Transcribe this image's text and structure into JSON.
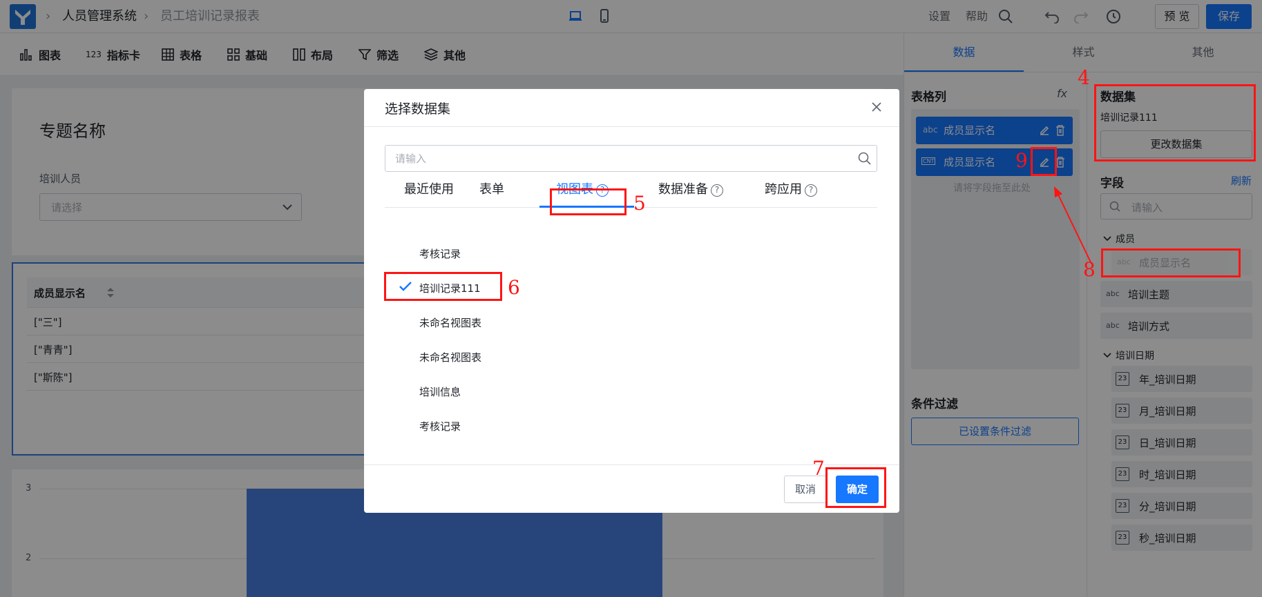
{
  "header": {
    "crumbs": [
      "人员管理系统",
      "员工培训记录报表"
    ],
    "settings_label": "设置",
    "help_label": "帮助",
    "preview_label": "预 览",
    "save_label": "保存"
  },
  "toolbar": {
    "items": [
      {
        "icon": "bar-chart-icon",
        "label": "图表"
      },
      {
        "icon": "number-card-icon",
        "label": "指标卡"
      },
      {
        "icon": "table-icon",
        "label": "表格"
      },
      {
        "icon": "grid-icon",
        "label": "基础"
      },
      {
        "icon": "layout-icon",
        "label": "布局"
      },
      {
        "icon": "filter-icon",
        "label": "筛选"
      },
      {
        "icon": "layers-icon",
        "label": "其他"
      }
    ]
  },
  "canvas": {
    "topic_title": "专题名称",
    "filter_label": "培训人员",
    "filter_placeholder": "请选择",
    "table_header": "成员显示名",
    "table_rows": [
      "[\"三\"]",
      "[\"青青\"]",
      "[\"斯陈\"]"
    ],
    "chart_y_ticks": [
      "3",
      "2"
    ]
  },
  "right_panel": {
    "tabs": [
      "数据",
      "样式",
      "其他"
    ],
    "table_columns_title": "表格列",
    "fx_label": "fx",
    "columns": [
      {
        "type_badge": "abc",
        "label": "成员显示名"
      },
      {
        "type_badge": "CNT",
        "label": "成员显示名"
      }
    ],
    "drop_hint": "请将字段拖至此处",
    "condition_filter_title": "条件过滤",
    "condition_filter_button": "已设置条件过滤",
    "dataset_title": "数据集",
    "dataset_name": "培训记录111",
    "change_dataset_label": "更改数据集",
    "fields_title": "字段",
    "refresh_label": "刷新",
    "field_search_placeholder": "请输入",
    "groups": [
      {
        "name": "成员",
        "fields": [
          {
            "badge": "abc",
            "label": "成员显示名"
          }
        ]
      },
      {
        "name": null,
        "fields": [
          {
            "badge": "abc",
            "label": "培训主题"
          },
          {
            "badge": "abc",
            "label": "培训方式"
          }
        ]
      },
      {
        "name": "培训日期",
        "fields": [
          {
            "badge": "23",
            "label": "年_培训日期"
          },
          {
            "badge": "23",
            "label": "月_培训日期"
          },
          {
            "badge": "23",
            "label": "日_培训日期"
          },
          {
            "badge": "23",
            "label": "时_培训日期"
          },
          {
            "badge": "23",
            "label": "分_培训日期"
          },
          {
            "badge": "23",
            "label": "秒_培训日期"
          }
        ]
      }
    ]
  },
  "modal": {
    "title": "选择数据集",
    "search_placeholder": "请输入",
    "tabs": [
      {
        "label": "最近使用",
        "help": false
      },
      {
        "label": "表单",
        "help": false
      },
      {
        "label": "视图表",
        "help": true
      },
      {
        "label": "数据准备",
        "help": true
      },
      {
        "label": "跨应用",
        "help": true
      }
    ],
    "active_tab": "视图表",
    "items": [
      "考核记录",
      "培训记录111",
      "未命名视图表",
      "未命名视图表",
      "培训信息",
      "考核记录"
    ],
    "selected_item": "培训记录111",
    "cancel_label": "取消",
    "ok_label": "确定"
  },
  "annotations": {
    "numbers": [
      "4",
      "5",
      "6",
      "7",
      "8",
      "9"
    ],
    "color": "#ff1414"
  }
}
